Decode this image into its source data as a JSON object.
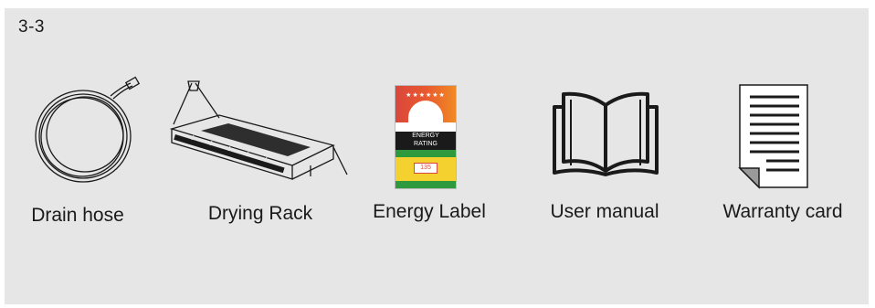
{
  "section_label": "3-3",
  "items": [
    {
      "label": "Drain hose",
      "icon": "drain-hose-icon"
    },
    {
      "label": "Drying Rack",
      "icon": "drying-rack-icon"
    },
    {
      "label": "Energy Label",
      "icon": "energy-label-icon",
      "label_art": {
        "line1": "ENERGY",
        "line2": "RATING",
        "value": "135"
      }
    },
    {
      "label": "User manual",
      "icon": "book-icon"
    },
    {
      "label": "Warranty card",
      "icon": "warranty-card-icon"
    }
  ],
  "colors": {
    "panel": "#e6e6e6",
    "ink": "#1a1a1a",
    "energy_red": "#d9473c",
    "energy_orange": "#f08a24",
    "energy_green": "#2f9a3d",
    "energy_yellow": "#f5d130"
  }
}
